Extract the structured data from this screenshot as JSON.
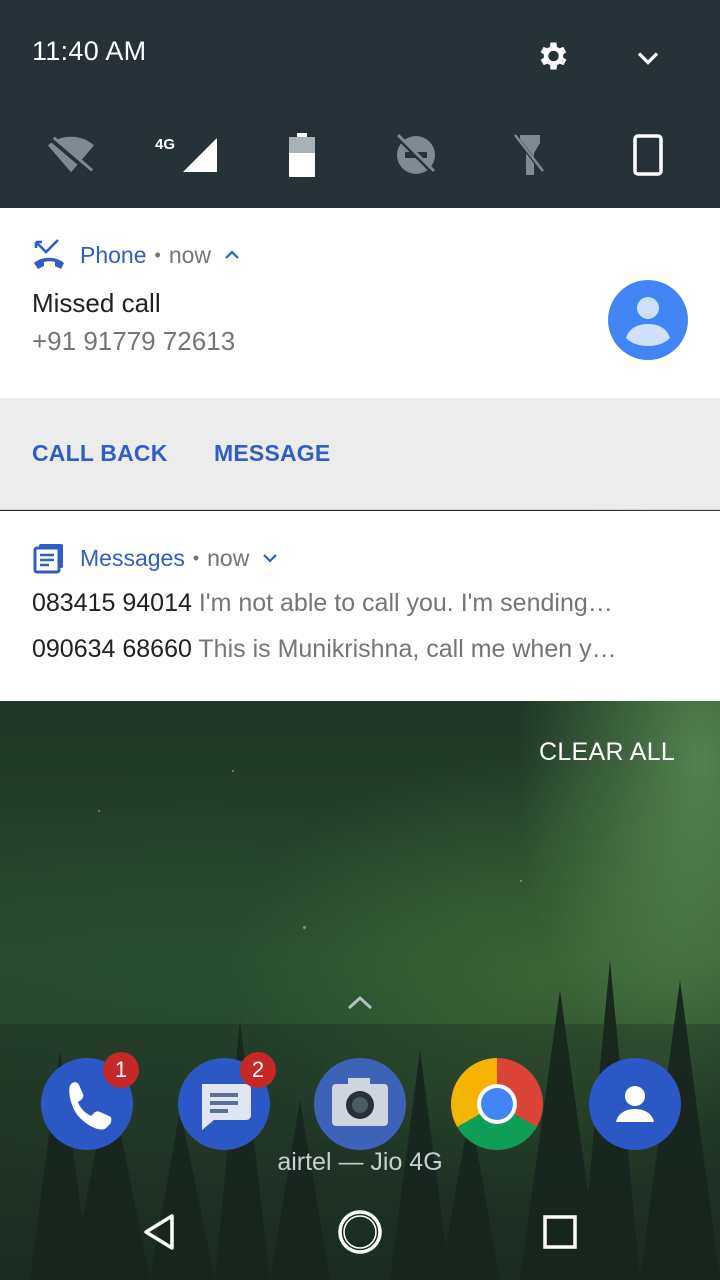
{
  "status_bar": {
    "time": "11:40 AM",
    "network_label": "4G"
  },
  "quick_settings": {
    "tiles": [
      "wifi-off-icon",
      "cellular-4g-icon",
      "battery-icon",
      "do-not-disturb-off-icon",
      "flashlight-off-icon",
      "screen-rotation-portrait-icon"
    ]
  },
  "notifications": {
    "phone": {
      "app_name": "Phone",
      "when": "now",
      "title": "Missed call",
      "number": "+91 91779 72613",
      "actions": [
        "CALL BACK",
        "MESSAGE"
      ]
    },
    "messages": {
      "app_name": "Messages",
      "when": "now",
      "items": [
        {
          "sender": "083415 94014",
          "preview": "I'm not able to call you. I'm sending…"
        },
        {
          "sender": "090634 68660",
          "preview": "This is Munikrishna, call me when y…"
        }
      ]
    },
    "clear_all": "CLEAR ALL"
  },
  "home": {
    "dock": [
      {
        "app": "Phone",
        "icon": "phone-icon",
        "badge": "1"
      },
      {
        "app": "Messages",
        "icon": "messages-icon",
        "badge": "2"
      },
      {
        "app": "Camera",
        "icon": "camera-icon",
        "badge": ""
      },
      {
        "app": "Chrome",
        "icon": "chrome-icon",
        "badge": ""
      },
      {
        "app": "Contacts",
        "icon": "contacts-icon",
        "badge": ""
      }
    ],
    "carrier": "airtel — Jio 4G"
  },
  "colors": {
    "status_bg": "#263238",
    "accent": "#2f5ec4",
    "avatar": "#4285f4",
    "badge": "#c62828"
  }
}
